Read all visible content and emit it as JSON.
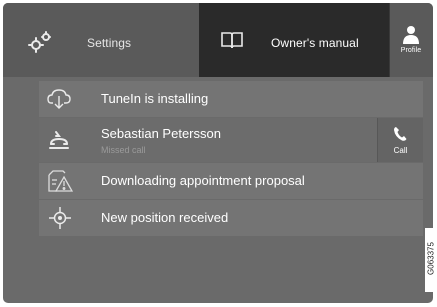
{
  "topbar": {
    "settings_label": "Settings",
    "manual_label": "Owner's manual",
    "profile_label": "Profile"
  },
  "notifications": [
    {
      "icon": "cloud-download-icon",
      "text": "TuneIn is installing"
    },
    {
      "icon": "missed-call-icon",
      "text": "Sebastian Petersson",
      "subtext": "Missed call",
      "action": "Call"
    },
    {
      "icon": "appointment-warning-icon",
      "text": "Downloading appointment proposal"
    },
    {
      "icon": "position-target-icon",
      "text": "New position received"
    }
  ],
  "reference_code": "G063375",
  "colors": {
    "panel": "#6a6a6a",
    "active_tab": "#2a2a2a",
    "text": "#ffffff"
  }
}
